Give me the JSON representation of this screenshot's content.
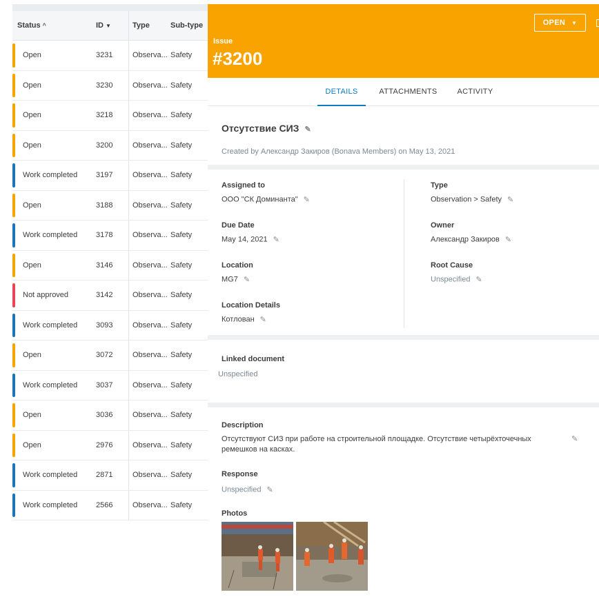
{
  "table": {
    "columns": {
      "status": "Status",
      "id": "ID",
      "type": "Type",
      "subtype": "Sub-type"
    },
    "rows": [
      {
        "status": "Open",
        "id": "3231",
        "type": "Observa...",
        "subtype": "Safety",
        "color": "#f8a300"
      },
      {
        "status": "Open",
        "id": "3230",
        "type": "Observa...",
        "subtype": "Safety",
        "color": "#f8a300"
      },
      {
        "status": "Open",
        "id": "3218",
        "type": "Observa...",
        "subtype": "Safety",
        "color": "#f8a300"
      },
      {
        "status": "Open",
        "id": "3200",
        "type": "Observa...",
        "subtype": "Safety",
        "color": "#f8a300"
      },
      {
        "status": "Work completed",
        "id": "3197",
        "type": "Observa...",
        "subtype": "Safety",
        "color": "#1b75bb"
      },
      {
        "status": "Open",
        "id": "3188",
        "type": "Observa...",
        "subtype": "Safety",
        "color": "#f8a300"
      },
      {
        "status": "Work completed",
        "id": "3178",
        "type": "Observa...",
        "subtype": "Safety",
        "color": "#1b75bb"
      },
      {
        "status": "Open",
        "id": "3146",
        "type": "Observa...",
        "subtype": "Safety",
        "color": "#f8a300"
      },
      {
        "status": "Not approved",
        "id": "3142",
        "type": "Observa...",
        "subtype": "Safety",
        "color": "#e8455a"
      },
      {
        "status": "Work completed",
        "id": "3093",
        "type": "Observa...",
        "subtype": "Safety",
        "color": "#1b75bb"
      },
      {
        "status": "Open",
        "id": "3072",
        "type": "Observa...",
        "subtype": "Safety",
        "color": "#f8a300"
      },
      {
        "status": "Work completed",
        "id": "3037",
        "type": "Observa...",
        "subtype": "Safety",
        "color": "#1b75bb"
      },
      {
        "status": "Open",
        "id": "3036",
        "type": "Observa...",
        "subtype": "Safety",
        "color": "#f8a300"
      },
      {
        "status": "Open",
        "id": "2976",
        "type": "Observa...",
        "subtype": "Safety",
        "color": "#f8a300"
      },
      {
        "status": "Work completed",
        "id": "2871",
        "type": "Observa...",
        "subtype": "Safety",
        "color": "#1b75bb"
      },
      {
        "status": "Work completed",
        "id": "2566",
        "type": "Observa...",
        "subtype": "Safety",
        "color": "#1b75bb"
      }
    ]
  },
  "header": {
    "label": "Issue",
    "number": "#3200",
    "status_button": "OPEN",
    "color": "#f8a300"
  },
  "tabs": {
    "details": "DETAILS",
    "attachments": "ATTACHMENTS",
    "activity": "ACTIVITY"
  },
  "issue": {
    "title": "Отсутствие СИЗ",
    "created": "Created by Александр Закиров (Bonava Members) on May 13, 2021"
  },
  "fields": {
    "assigned_to_label": "Assigned to",
    "assigned_to": "ООО \"СК Доминанта\"",
    "due_date_label": "Due Date",
    "due_date": "May 14, 2021",
    "location_label": "Location",
    "location": "MG7",
    "location_details_label": "Location Details",
    "location_details": "Котлован",
    "type_label": "Type",
    "type": "Observation > Safety",
    "owner_label": "Owner",
    "owner": "Александр Закиров",
    "root_cause_label": "Root Cause",
    "root_cause": "Unspecified"
  },
  "linked": {
    "label": "Linked document",
    "value": "Unspecified"
  },
  "description": {
    "label": "Description",
    "line1": "Отсутствуют СИЗ при работе на строительной площадке. Отсутствие четырёхточечных",
    "line2": "ремешков на касках.",
    "response_label": "Response",
    "response": "Unspecified",
    "photos_label": "Photos"
  },
  "icons": {
    "sort": "sort-ascending-icon",
    "chevron": "chevron-down-icon",
    "pencil": "pencil-icon",
    "caret": "caret-down-icon"
  }
}
